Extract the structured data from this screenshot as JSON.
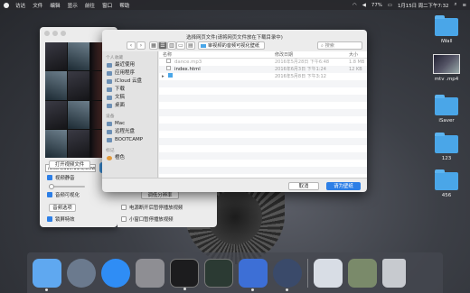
{
  "menubar": {
    "items": [
      "访达",
      "文件",
      "编辑",
      "显示",
      "前往",
      "窗口",
      "帮助"
    ],
    "battery": "77%",
    "clock": "1月15日 周二下午7:32"
  },
  "desktop": {
    "icons": [
      {
        "label": "iWall"
      },
      {
        "label": "mtv .mp4"
      },
      {
        "label": "iSaver"
      },
      {
        "label": "123"
      },
      {
        "label": "456"
      }
    ]
  },
  "player": {
    "path": "/Users/a10.11.5/Downloa",
    "open_button": "打开视频文件",
    "video_mute": "视频静音",
    "audio_visual": "音频可视化",
    "audio_option": "音频选项",
    "lock_effect": "锁屏特效",
    "extra_btn": "调低分辨率",
    "opt1": "电源断开后暂停播放视频",
    "opt2": "小窗口暂停播放视频"
  },
  "dialog": {
    "title": "选择网页文件(请将网页文件放在下载目录中)",
    "location": "审视频的音频可视化壁纸",
    "search_placeholder": "搜索",
    "sidebar": {
      "favorites_header": "个人收藏",
      "favorites": [
        "最近使用",
        "应用程序",
        "iCloud 云盘",
        "下载",
        "文稿",
        "桌面"
      ],
      "devices_header": "设备",
      "devices": [
        "Mac",
        "远程光盘",
        "BOOTCAMP"
      ],
      "tags_header": "标记",
      "tags": [
        "橙色"
      ]
    },
    "columns": {
      "name": "名称",
      "date": "修改日期",
      "size": "大小"
    },
    "files": [
      {
        "name": "dance.mp3",
        "date": "2016年5月28日 下午6:48",
        "size": "1.8 MB",
        "dim": true
      },
      {
        "name": "index.html",
        "date": "2016年6月3日 下午1:24",
        "size": "12 KB",
        "dim": false
      },
      {
        "name": "",
        "date": "2016年5月8日 下午3:12",
        "size": "",
        "dim": false
      }
    ],
    "cancel": "取消",
    "open": "请为壁纸"
  },
  "colors": {
    "accent": "#2d7fe6",
    "folder": "#4aa6e8"
  },
  "dock": {
    "apps": [
      {
        "icon": "finder-icon",
        "color": "#5fa8f0"
      },
      {
        "icon": "launchpad-icon",
        "color": "#6b7a8e"
      },
      {
        "icon": "app-store-icon",
        "color": "#2f8df5"
      },
      {
        "icon": "system-preferences-icon",
        "color": "#8e8e93"
      },
      {
        "icon": "terminal-icon",
        "color": "#1c1c1e"
      },
      {
        "icon": "activity-monitor-icon",
        "color": "#2b3a33"
      },
      {
        "icon": "xcode-icon",
        "color": "#3d6fd6"
      },
      {
        "icon": "quicktime-icon",
        "color": "#3a4a6a"
      },
      {
        "icon": "screenshot-stack-icon",
        "color": "#d8dde5"
      },
      {
        "icon": "photo-stack-icon",
        "color": "#7a8a6a"
      },
      {
        "icon": "trash-icon",
        "color": "#c7cacf"
      }
    ]
  }
}
